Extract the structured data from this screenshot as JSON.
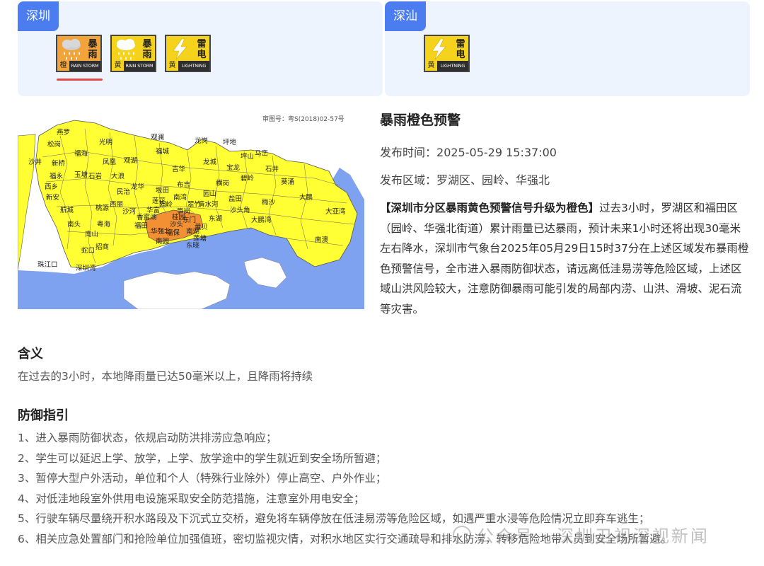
{
  "regions": [
    {
      "name": "深圳",
      "icons": [
        {
          "name": "rainstorm-orange-icon",
          "title_chars": [
            "暴",
            "雨"
          ],
          "level": "橙",
          "en": "RAIN STORM",
          "color": "#f2a33a",
          "active": true
        },
        {
          "name": "rainstorm-yellow-icon",
          "title_chars": [
            "暴",
            "雨"
          ],
          "level": "黄",
          "en": "RAIN STORM",
          "color": "#f5d21b",
          "active": false
        },
        {
          "name": "lightning-yellow-icon",
          "title_chars": [
            "雷",
            "电"
          ],
          "level": "黄",
          "en": "LIGHTNING",
          "color": "#f5d21b",
          "active": false
        }
      ]
    },
    {
      "name": "深汕",
      "icons": [
        {
          "name": "lightning-yellow-icon",
          "title_chars": [
            "雷",
            "电"
          ],
          "level": "黄",
          "en": "LIGHTNING",
          "color": "#f5d21b",
          "active": false
        }
      ]
    }
  ],
  "map": {
    "approval_no": "审图号：粤S(2018)02-57号",
    "labels": [
      "燕罗",
      "松岗",
      "沙井",
      "新桥",
      "福海",
      "新安",
      "西乡",
      "航城",
      "福永",
      "石岩",
      "光明",
      "玉塘",
      "凤凰",
      "观湖",
      "民治",
      "龙华",
      "大浪",
      "福城",
      "观澜",
      "坂田",
      "南湾",
      "布吉",
      "吉华",
      "龙岗",
      "坪地",
      "龙城",
      "宝龙",
      "坪山",
      "马峦",
      "碧岭",
      "石井",
      "横岗",
      "园山",
      "盐田",
      "沙头角",
      "梅沙",
      "葵涌",
      "大鹏",
      "南澳",
      "大亚湾",
      "南头",
      "南山",
      "粤海",
      "招商",
      "蛇口",
      "桃源",
      "西丽",
      "沙河",
      "香蜜湖",
      "莲花",
      "福田",
      "华富",
      "园岭",
      "华强北",
      "南园",
      "沙头",
      "福保",
      "东门",
      "黄贝",
      "翠竹",
      "清水河",
      "笋岗",
      "桂园",
      "南湖",
      "莲塘",
      "东湖",
      "东晓",
      "珠江口",
      "深圳湾",
      "大鹏湾"
    ],
    "colors": {
      "yellow": "#ffff33",
      "orange": "#f29033",
      "sea": "#7ea1f0",
      "border": "#555555"
    }
  },
  "warning": {
    "title": "暴雨橙色预警",
    "time_label": "发布时间：",
    "time": "2025-05-29 15:37:00",
    "area_label": "发布区域：",
    "area": "罗湖区、园岭、华强北",
    "headline": "【深圳市分区暴雨黄色预警信号升级为橙色】",
    "body": "过去3小时，罗湖区和福田区（园岭、华强北街道）累计雨量已达暴雨，预计未来1小时还将出现30毫米左右降水，深圳市气象台2025年05月29日15时37分在上述区域发布暴雨橙色预警信号，全市进入暴雨防御状态，请远离低洼易涝等危险区域，上述区域山洪风险较大，注意防御暴雨可能引发的局部内涝、山洪、滑坡、泥石流等灾害。"
  },
  "meaning": {
    "title": "含义",
    "text": "在过去的3小时，本地降雨量已达50毫米以上，且降雨将持续"
  },
  "guide": {
    "title": "防御指引",
    "items": [
      "1、进入暴雨防御状态，依规启动防洪排涝应急响应；",
      "2、学生可以延迟上学、放学，上学、放学途中的学生就近到安全场所暂避；",
      "3、暂停大型户外活动，单位和个人（特殊行业除外）停止高空、户外作业；",
      "4、对低洼地段室外供用电设施采取安全防范措施，注意室外用电安全；",
      "5、行驶车辆尽量绕开积水路段及下沉式立交桥，避免将车辆停放在低洼易涝等危险区域，如遇严重水浸等危险情况立即弃车逃生；",
      "6、相关应急处置部门和抢险单位加强值班，密切监视灾情，对积水地区实行交通疏导和排水防涝，转移危险地带人员到安全场所暂避。"
    ]
  },
  "watermark": "公众号 · 深圳卫视深视新闻"
}
